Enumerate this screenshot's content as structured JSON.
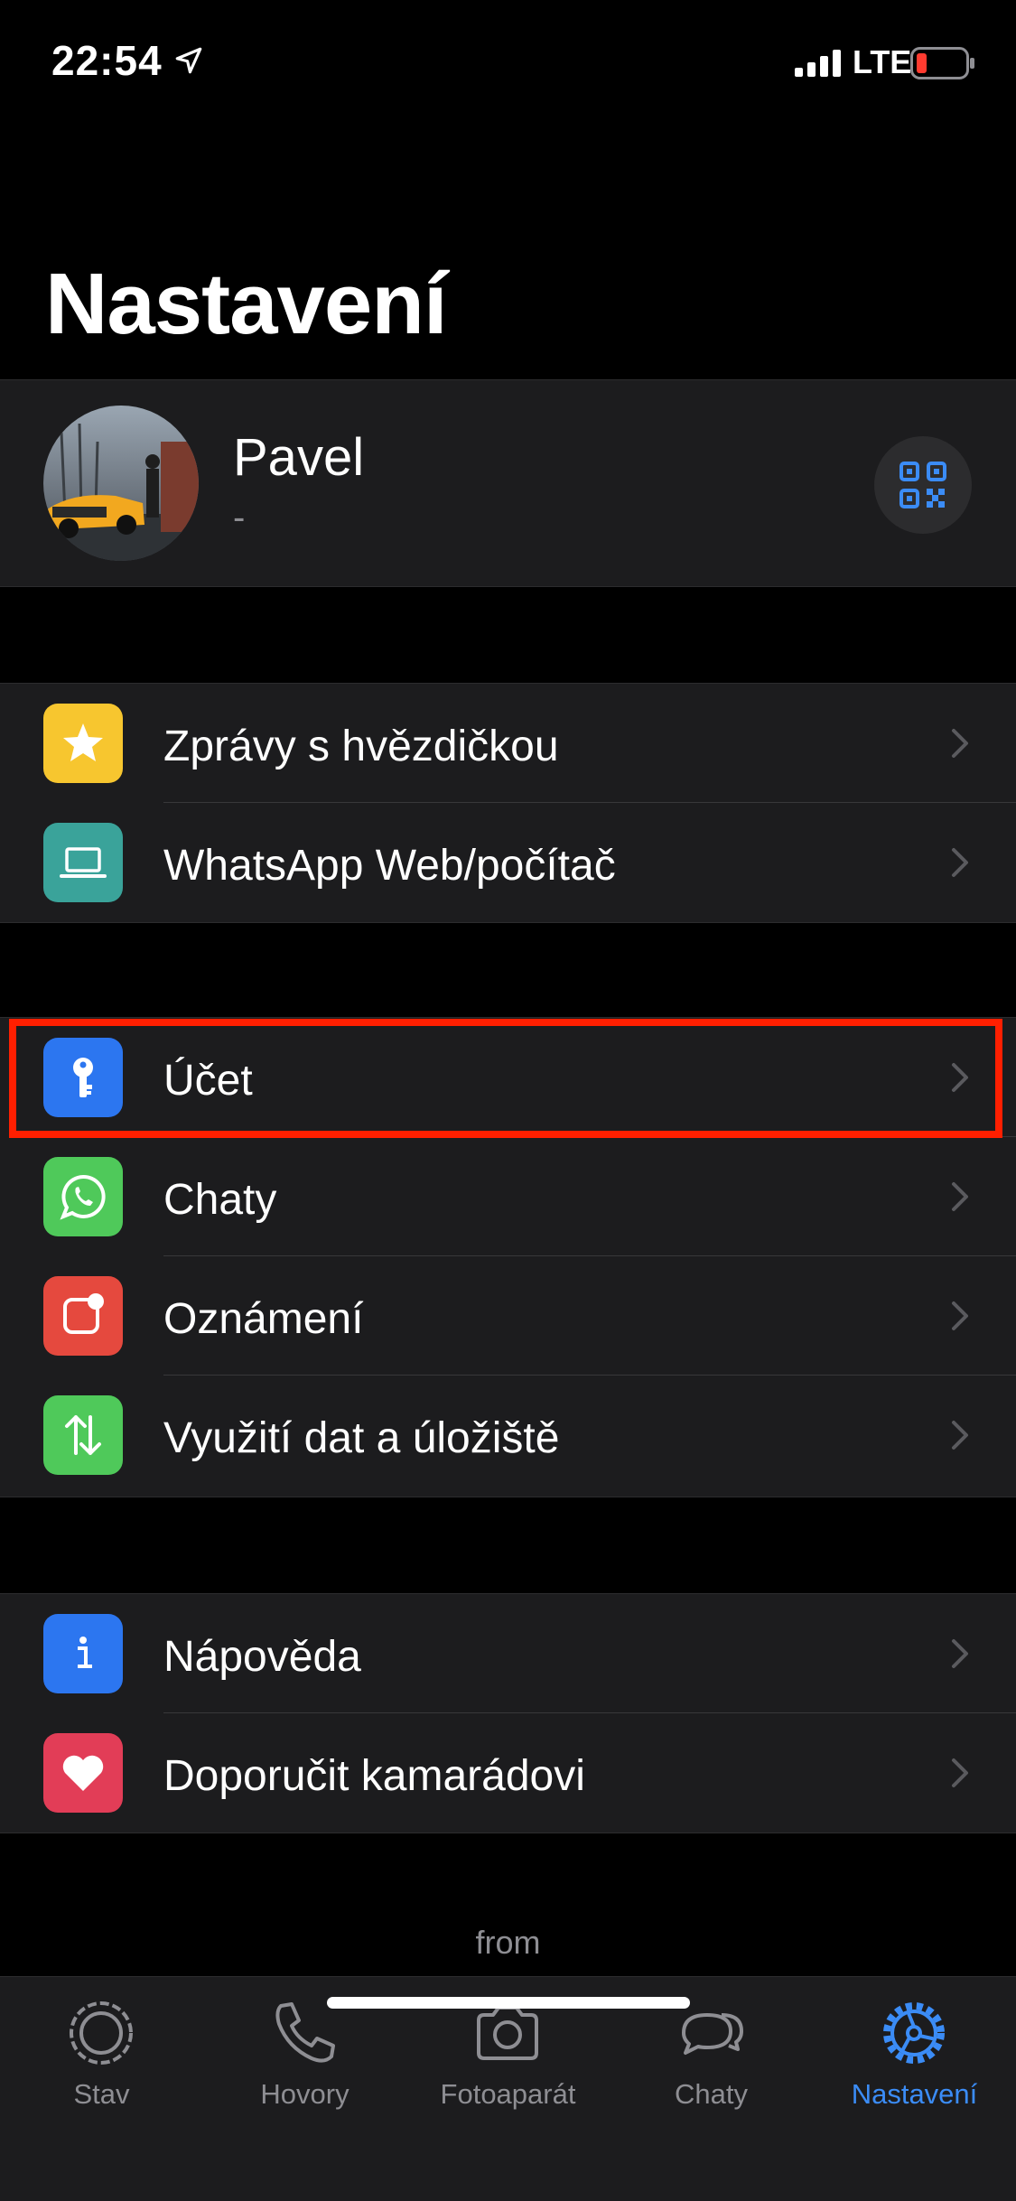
{
  "status_bar": {
    "time": "22:54",
    "network": "LTE"
  },
  "header": {
    "title": "Nastavení"
  },
  "profile": {
    "name": "Pavel",
    "status": "-"
  },
  "groups": [
    {
      "items": [
        {
          "label": "Zprávy s hvězdičkou",
          "icon": "star-icon",
          "color": "#f7c62f"
        },
        {
          "label": "WhatsApp Web/počítač",
          "icon": "laptop-icon",
          "color": "#3aa39a"
        }
      ]
    },
    {
      "items": [
        {
          "label": "Účet",
          "icon": "key-icon",
          "color": "#2c76f0",
          "highlighted": true
        },
        {
          "label": "Chaty",
          "icon": "whatsapp-icon",
          "color": "#4fc95a"
        },
        {
          "label": "Oznámení",
          "icon": "notification-icon",
          "color": "#e5493e"
        },
        {
          "label": "Využití dat a úložiště",
          "icon": "data-arrows-icon",
          "color": "#4fc95a"
        }
      ]
    },
    {
      "items": [
        {
          "label": "Nápověda",
          "icon": "info-icon",
          "color": "#2c76f0"
        },
        {
          "label": "Doporučit kamarádovi",
          "icon": "heart-icon",
          "color": "#e23d57"
        }
      ]
    }
  ],
  "footer": {
    "from": "from"
  },
  "tabs": [
    {
      "label": "Stav",
      "icon": "status-icon",
      "active": false
    },
    {
      "label": "Hovory",
      "icon": "phone-icon",
      "active": false
    },
    {
      "label": "Fotoaparát",
      "icon": "camera-icon",
      "active": false
    },
    {
      "label": "Chaty",
      "icon": "chat-bubbles-icon",
      "active": false
    },
    {
      "label": "Nastavení",
      "icon": "settings-gear-icon",
      "active": true
    }
  ],
  "colors": {
    "accent": "#3b8cf6",
    "highlight_border": "#ff1f00",
    "cell_background": "#1c1c1e"
  }
}
